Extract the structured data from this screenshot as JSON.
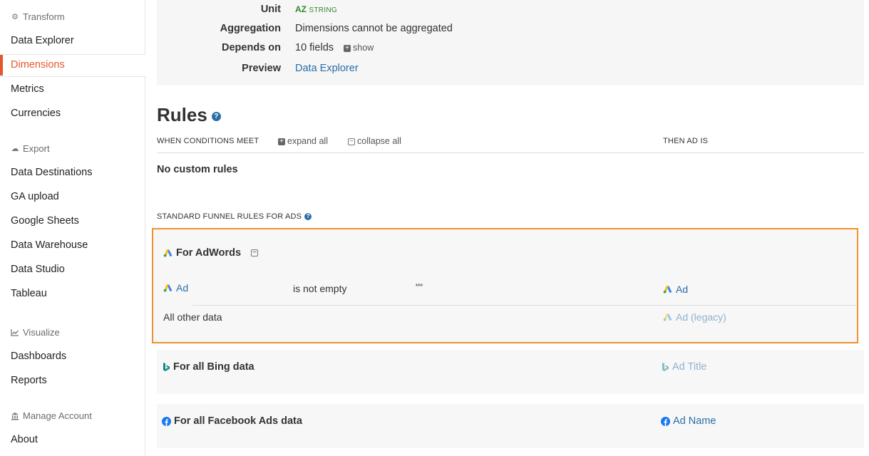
{
  "sidebar": {
    "transform_section": "Transform",
    "transform_items": [
      "Data Explorer",
      "Dimensions",
      "Metrics",
      "Currencies"
    ],
    "export_section": "Export",
    "export_items": [
      "Data Destinations",
      "GA upload",
      "Google Sheets",
      "Data Warehouse",
      "Data Studio",
      "Tableau"
    ],
    "visualize_section": "Visualize",
    "visualize_items": [
      "Dashboards",
      "Reports"
    ],
    "account_section": "Manage Account",
    "account_items": [
      "About"
    ],
    "active_item": "Dimensions"
  },
  "info": {
    "unit_label": "Unit",
    "unit_badge": "AZ",
    "unit_type": "STRING",
    "aggregation_label": "Aggregation",
    "aggregation_value": "Dimensions cannot be aggregated",
    "depends_label": "Depends on",
    "depends_value": "10 fields",
    "show_label": "show",
    "preview_label": "Preview",
    "preview_link": "Data Explorer"
  },
  "rules": {
    "title": "Rules",
    "when_header": "WHEN CONDITIONS MEET",
    "expand_all": "expand all",
    "collapse_all": "collapse all",
    "then_header": "THEN AD IS",
    "no_custom": "No custom rules",
    "standard_header": "STANDARD FUNNEL RULES FOR ADS"
  },
  "adwords": {
    "title": "For AdWords",
    "row1_field": "Ad",
    "row1_operator": "is not empty",
    "row1_value": "\"\"",
    "row1_target": "Ad",
    "row2_field": "All other data",
    "row2_target": "Ad (legacy)"
  },
  "bing": {
    "title": "For all Bing data",
    "target": "Ad Title"
  },
  "facebook": {
    "title": "For all Facebook Ads data",
    "target": "Ad Name"
  },
  "colors": {
    "accent": "#e4572e",
    "highlight_border": "#f0922b",
    "link": "#2a6ea6",
    "string_badge": "#2e8b2e"
  }
}
